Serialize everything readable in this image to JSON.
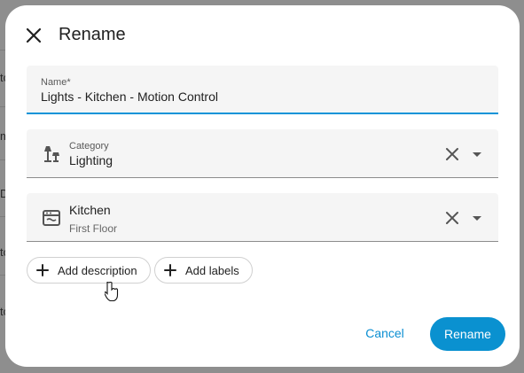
{
  "dialog": {
    "title": "Rename",
    "close_icon": "close-icon"
  },
  "fields": {
    "name": {
      "label": "Name*",
      "value": "Lights - Kitchen - Motion Control"
    },
    "category": {
      "label": "Category",
      "value": "Lighting",
      "icon": "lamp-icon"
    },
    "area": {
      "name": "Kitchen",
      "floor": "First Floor",
      "icon": "stove-icon"
    }
  },
  "chips": {
    "add_description": "Add description",
    "add_labels": "Add labels"
  },
  "actions": {
    "cancel": "Cancel",
    "rename": "Rename"
  },
  "background_fragments": [
    "tc",
    "m",
    "D",
    "tc",
    "tc"
  ],
  "colors": {
    "accent": "#0a91d0",
    "field_bg": "#f5f5f5"
  }
}
